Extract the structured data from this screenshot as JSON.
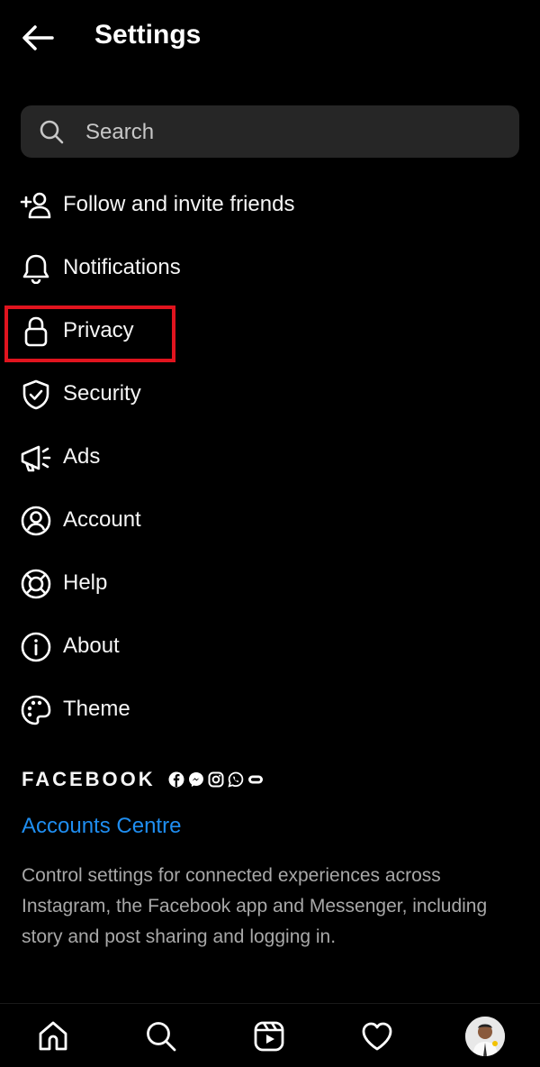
{
  "header": {
    "title": "Settings"
  },
  "search": {
    "placeholder": "Search"
  },
  "menu": {
    "items": [
      {
        "label": "Follow and invite friends",
        "icon": "add-person-icon"
      },
      {
        "label": "Notifications",
        "icon": "bell-icon"
      },
      {
        "label": "Privacy",
        "icon": "lock-icon"
      },
      {
        "label": "Security",
        "icon": "shield-check-icon"
      },
      {
        "label": "Ads",
        "icon": "megaphone-icon"
      },
      {
        "label": "Account",
        "icon": "user-circle-icon"
      },
      {
        "label": "Help",
        "icon": "lifebuoy-icon"
      },
      {
        "label": "About",
        "icon": "info-icon"
      },
      {
        "label": "Theme",
        "icon": "palette-icon"
      }
    ]
  },
  "highlight": {
    "color": "#e0141e"
  },
  "facebook": {
    "brand": "FACEBOOK",
    "link": "Accounts Centre",
    "link_color": "#1f8ef1",
    "description": "Control settings for connected experiences across Instagram, the Facebook app and Messenger, including story and post sharing and logging in."
  },
  "colors": {
    "background": "#000000",
    "text": "#f5f5f5",
    "muted": "#a8a8a8",
    "search_bg": "#262626"
  },
  "bottom_nav": [
    "home-icon",
    "search-icon",
    "reels-icon",
    "heart-icon",
    "profile-avatar"
  ]
}
